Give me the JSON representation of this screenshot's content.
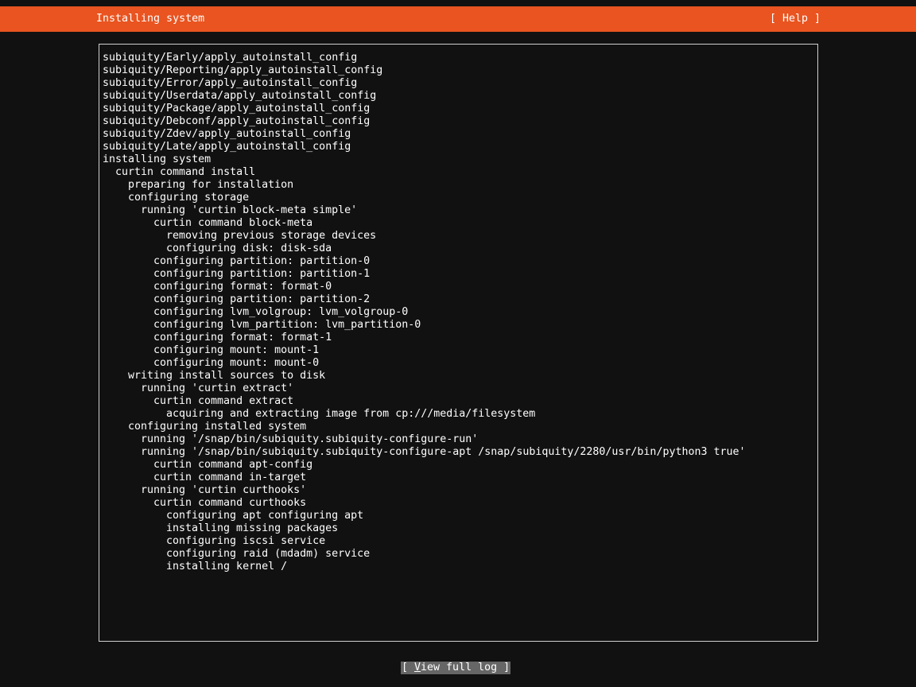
{
  "header": {
    "title": "Installing system",
    "help_label": "[ Help ]"
  },
  "log": {
    "lines": [
      {
        "indent": 0,
        "text": "subiquity/Early/apply_autoinstall_config"
      },
      {
        "indent": 0,
        "text": "subiquity/Reporting/apply_autoinstall_config"
      },
      {
        "indent": 0,
        "text": "subiquity/Error/apply_autoinstall_config"
      },
      {
        "indent": 0,
        "text": "subiquity/Userdata/apply_autoinstall_config"
      },
      {
        "indent": 0,
        "text": "subiquity/Package/apply_autoinstall_config"
      },
      {
        "indent": 0,
        "text": "subiquity/Debconf/apply_autoinstall_config"
      },
      {
        "indent": 0,
        "text": "subiquity/Zdev/apply_autoinstall_config"
      },
      {
        "indent": 0,
        "text": "subiquity/Late/apply_autoinstall_config"
      },
      {
        "indent": 0,
        "text": "installing system"
      },
      {
        "indent": 1,
        "text": "curtin command install"
      },
      {
        "indent": 2,
        "text": "preparing for installation"
      },
      {
        "indent": 2,
        "text": "configuring storage"
      },
      {
        "indent": 3,
        "text": "running 'curtin block-meta simple'"
      },
      {
        "indent": 4,
        "text": "curtin command block-meta"
      },
      {
        "indent": 5,
        "text": "removing previous storage devices"
      },
      {
        "indent": 5,
        "text": "configuring disk: disk-sda"
      },
      {
        "indent": 4,
        "text": "configuring partition: partition-0"
      },
      {
        "indent": 4,
        "text": "configuring partition: partition-1"
      },
      {
        "indent": 4,
        "text": "configuring format: format-0"
      },
      {
        "indent": 4,
        "text": "configuring partition: partition-2"
      },
      {
        "indent": 4,
        "text": "configuring lvm_volgroup: lvm_volgroup-0"
      },
      {
        "indent": 4,
        "text": "configuring lvm_partition: lvm_partition-0"
      },
      {
        "indent": 4,
        "text": "configuring format: format-1"
      },
      {
        "indent": 4,
        "text": "configuring mount: mount-1"
      },
      {
        "indent": 4,
        "text": "configuring mount: mount-0"
      },
      {
        "indent": 2,
        "text": "writing install sources to disk"
      },
      {
        "indent": 3,
        "text": "running 'curtin extract'"
      },
      {
        "indent": 4,
        "text": "curtin command extract"
      },
      {
        "indent": 5,
        "text": "acquiring and extracting image from cp:///media/filesystem"
      },
      {
        "indent": 2,
        "text": "configuring installed system"
      },
      {
        "indent": 3,
        "text": "running '/snap/bin/subiquity.subiquity-configure-run'"
      },
      {
        "indent": 3,
        "text": "running '/snap/bin/subiquity.subiquity-configure-apt /snap/subiquity/2280/usr/bin/python3 true'"
      },
      {
        "indent": 4,
        "text": "curtin command apt-config"
      },
      {
        "indent": 4,
        "text": "curtin command in-target"
      },
      {
        "indent": 3,
        "text": "running 'curtin curthooks'"
      },
      {
        "indent": 4,
        "text": "curtin command curthooks"
      },
      {
        "indent": 5,
        "text": "configuring apt configuring apt"
      },
      {
        "indent": 5,
        "text": "installing missing packages"
      },
      {
        "indent": 5,
        "text": "configuring iscsi service"
      },
      {
        "indent": 5,
        "text": "configuring raid (mdadm) service"
      },
      {
        "indent": 5,
        "text": "installing kernel /"
      }
    ]
  },
  "footer": {
    "view_log_prefix": "[ ",
    "view_log_hotkey": "V",
    "view_log_rest": "iew full log ]"
  },
  "colors": {
    "header_bg": "#e95420",
    "background": "#111111",
    "text": "#ffffff",
    "button_bg": "#666666"
  }
}
